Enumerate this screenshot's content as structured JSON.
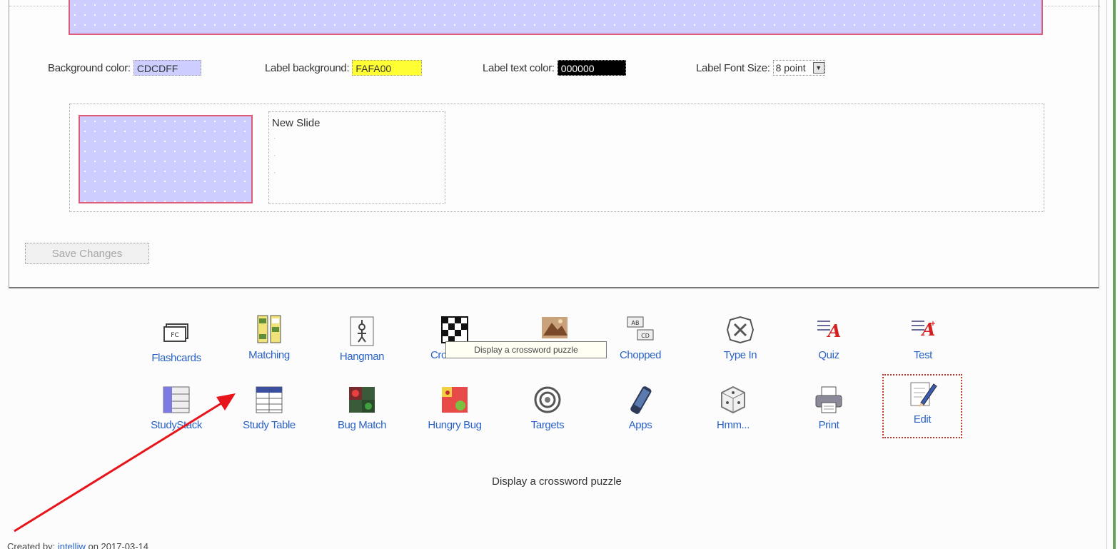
{
  "settings": {
    "background_color_label": "Background color:",
    "background_color_value": "CDCDFF",
    "label_background_label": "Label background:",
    "label_background_value": "FAFA00",
    "label_text_color_label": "Label text color:",
    "label_text_color_value": "000000",
    "font_size_label": "Label Font Size:",
    "font_size_value": "8 point"
  },
  "slide": {
    "title": "New Slide"
  },
  "save_button_label": "Save Changes",
  "tools": {
    "flashcards": "Flashcards",
    "matching": "Matching",
    "hangman": "Hangman",
    "crossword": "Crossword",
    "chopped": "Chopped",
    "type_in": "Type In",
    "quiz": "Quiz",
    "test": "Test",
    "study_stack": "StudyStack",
    "study_table": "Study Table",
    "bug_match": "Bug Match",
    "hungry_bug": "Hungry Bug",
    "targets": "Targets",
    "apps": "Apps",
    "hmm": "Hmm...",
    "print": "Print",
    "edit": "Edit"
  },
  "tooltip_text": "Display a crossword puzzle",
  "status_text": "Display a crossword puzzle",
  "footer": {
    "prefix": "Created by:",
    "user": "intelliw",
    "suffix": "on 2017-03-14"
  },
  "colors": {
    "slide_bg": "#CDCDFF",
    "label_bg": "#FAFA00",
    "label_text": "#000000",
    "annotation_arrow": "#E8141B",
    "link_blue": "#2A62C8"
  }
}
